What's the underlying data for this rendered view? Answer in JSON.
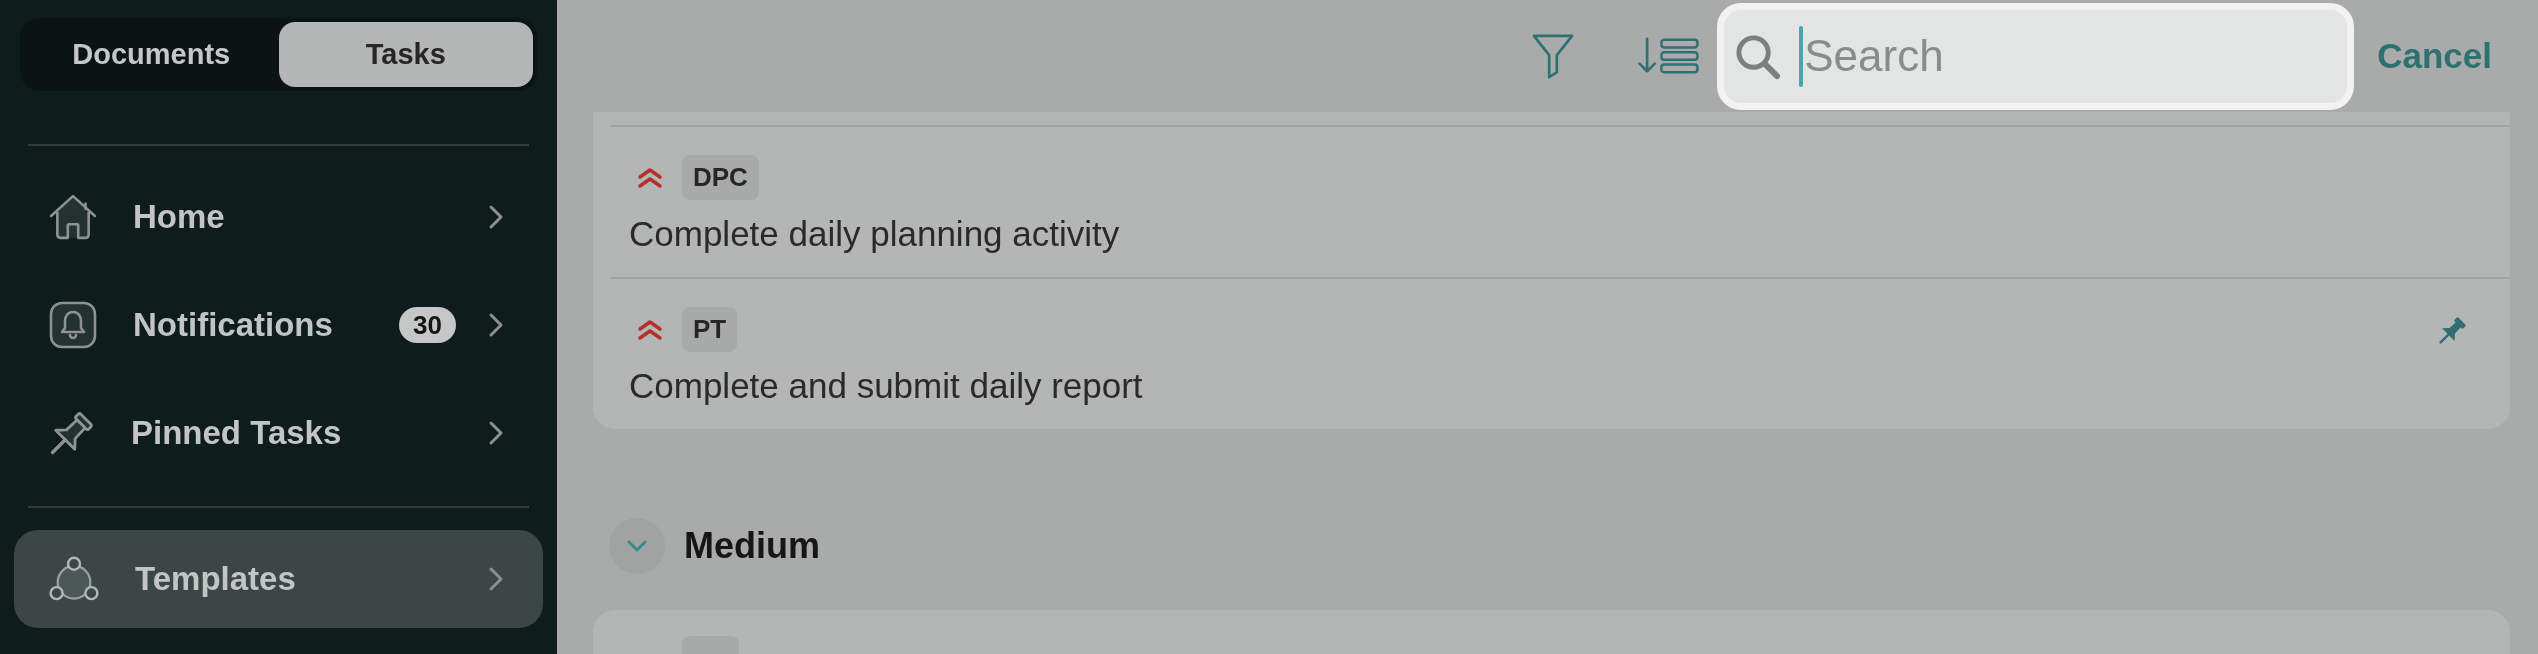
{
  "sidebar": {
    "segments": [
      {
        "label": "Documents",
        "selected": false
      },
      {
        "label": "Tasks",
        "selected": true
      }
    ],
    "sections": [
      {
        "items": [
          {
            "label": "Home",
            "selected": false
          },
          {
            "label": "Notifications",
            "badge": "30",
            "selected": false
          },
          {
            "label": "Pinned Tasks",
            "selected": false
          }
        ]
      },
      {
        "items": [
          {
            "label": "Templates",
            "selected": true
          }
        ]
      }
    ]
  },
  "toolbar": {
    "search": {
      "placeholder": "Search",
      "focused": true
    },
    "cancel": "Cancel"
  },
  "task_groups": [
    {
      "tasks": [
        {
          "kind": "high",
          "tag": "DPC",
          "title": "Complete daily planning activity",
          "pinned": false
        },
        {
          "kind": "high",
          "tag": "PT",
          "title": "Complete and submit daily report",
          "pinned": true
        }
      ]
    },
    {
      "title": "Medium",
      "expanded": true
    }
  ]
}
